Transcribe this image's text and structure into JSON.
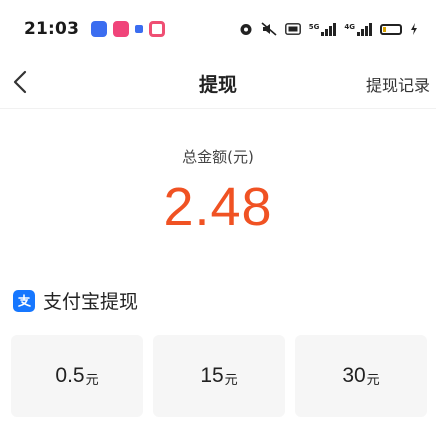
{
  "status_bar": {
    "time": "21:03",
    "app_icons": [
      "alipay-app-icon",
      "media-app-icon",
      "small-app-icon",
      "camera-app-icon"
    ],
    "right_icons": [
      "alarm-icon",
      "mute-icon",
      "hd-icon",
      "signal-5g-icon",
      "signal-4g-icon",
      "battery-icon"
    ],
    "signal_labels": [
      "5G",
      "4G"
    ],
    "battery_color": "#d8a200"
  },
  "navbar": {
    "title": "提现",
    "action": "提现记录"
  },
  "balance": {
    "label": "总金额(元)",
    "value": "2.48",
    "value_color": "#f05223"
  },
  "section": {
    "title": "支付宝提现",
    "icon": "alipay-icon",
    "icon_color": "#1677ff"
  },
  "options": [
    {
      "amount": "0.5",
      "unit": "元"
    },
    {
      "amount": "15",
      "unit": "元"
    },
    {
      "amount": "30",
      "unit": "元"
    }
  ]
}
